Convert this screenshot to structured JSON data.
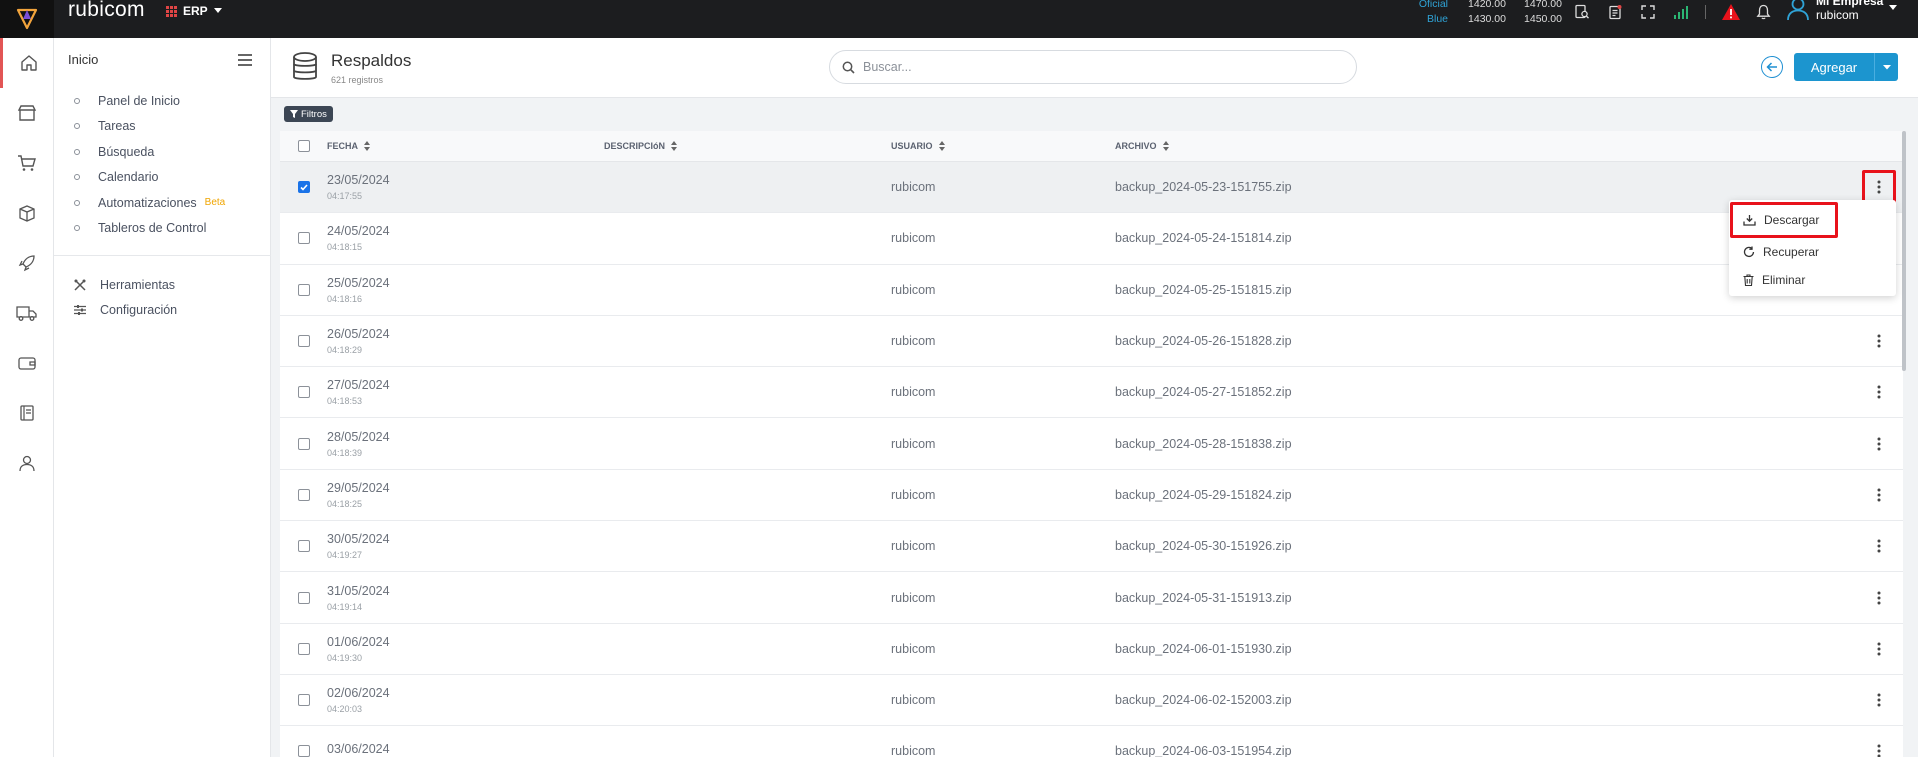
{
  "app": {
    "brand": "rubicom",
    "module": "ERP",
    "company_name": "Mi Empresa",
    "company_user": "rubicom"
  },
  "rates": [
    {
      "label": "Oficial",
      "buy": "1420.00",
      "sell": "1470.00"
    },
    {
      "label": "Blue",
      "buy": "1430.00",
      "sell": "1450.00"
    }
  ],
  "sidebar": {
    "title": "Inicio",
    "items": [
      {
        "label": "Panel de Inicio"
      },
      {
        "label": "Tareas"
      },
      {
        "label": "Búsqueda"
      },
      {
        "label": "Calendario"
      },
      {
        "label": "Automatizaciones",
        "badge": "Beta"
      },
      {
        "label": "Tableros de Control"
      }
    ],
    "tools": [
      {
        "label": "Herramientas",
        "icon": "tools-icon"
      },
      {
        "label": "Configuración",
        "icon": "sliders-icon"
      }
    ]
  },
  "rail_icons": [
    "home-icon",
    "store-icon",
    "cart-icon",
    "box-icon",
    "rocket-icon",
    "truck-icon",
    "wallet-icon",
    "ledger-icon",
    "user-icon"
  ],
  "header": {
    "title": "Respaldos",
    "subtitle": "621 registros",
    "search_placeholder": "Buscar...",
    "add_label": "Agregar"
  },
  "filter_label": "Filtros",
  "table": {
    "columns": [
      "FECHA",
      "DESCRIPCIóN",
      "USUARIO",
      "ARCHIVO"
    ],
    "rows": [
      {
        "date": "23/05/2024",
        "time": "04:17:55",
        "user": "rubicom",
        "file": "backup_2024-05-23-151755.zip",
        "checked": true
      },
      {
        "date": "24/05/2024",
        "time": "04:18:15",
        "user": "rubicom",
        "file": "backup_2024-05-24-151814.zip"
      },
      {
        "date": "25/05/2024",
        "time": "04:18:16",
        "user": "rubicom",
        "file": "backup_2024-05-25-151815.zip"
      },
      {
        "date": "26/05/2024",
        "time": "04:18:29",
        "user": "rubicom",
        "file": "backup_2024-05-26-151828.zip"
      },
      {
        "date": "27/05/2024",
        "time": "04:18:53",
        "user": "rubicom",
        "file": "backup_2024-05-27-151852.zip"
      },
      {
        "date": "28/05/2024",
        "time": "04:18:39",
        "user": "rubicom",
        "file": "backup_2024-05-28-151838.zip"
      },
      {
        "date": "29/05/2024",
        "time": "04:18:25",
        "user": "rubicom",
        "file": "backup_2024-05-29-151824.zip"
      },
      {
        "date": "30/05/2024",
        "time": "04:19:27",
        "user": "rubicom",
        "file": "backup_2024-05-30-151926.zip"
      },
      {
        "date": "31/05/2024",
        "time": "04:19:14",
        "user": "rubicom",
        "file": "backup_2024-05-31-151913.zip"
      },
      {
        "date": "01/06/2024",
        "time": "04:19:30",
        "user": "rubicom",
        "file": "backup_2024-06-01-151930.zip"
      },
      {
        "date": "02/06/2024",
        "time": "04:20:03",
        "user": "rubicom",
        "file": "backup_2024-06-02-152003.zip"
      },
      {
        "date": "03/06/2024",
        "time": "",
        "user": "rubicom",
        "file": "backup_2024-06-03-151954.zip"
      }
    ]
  },
  "row_menu": {
    "items": [
      "Descargar",
      "Recuperar",
      "Eliminar"
    ]
  },
  "colors": {
    "accent": "#1c95cf",
    "highlight": "#e8121b",
    "beta": "#f0a500"
  }
}
